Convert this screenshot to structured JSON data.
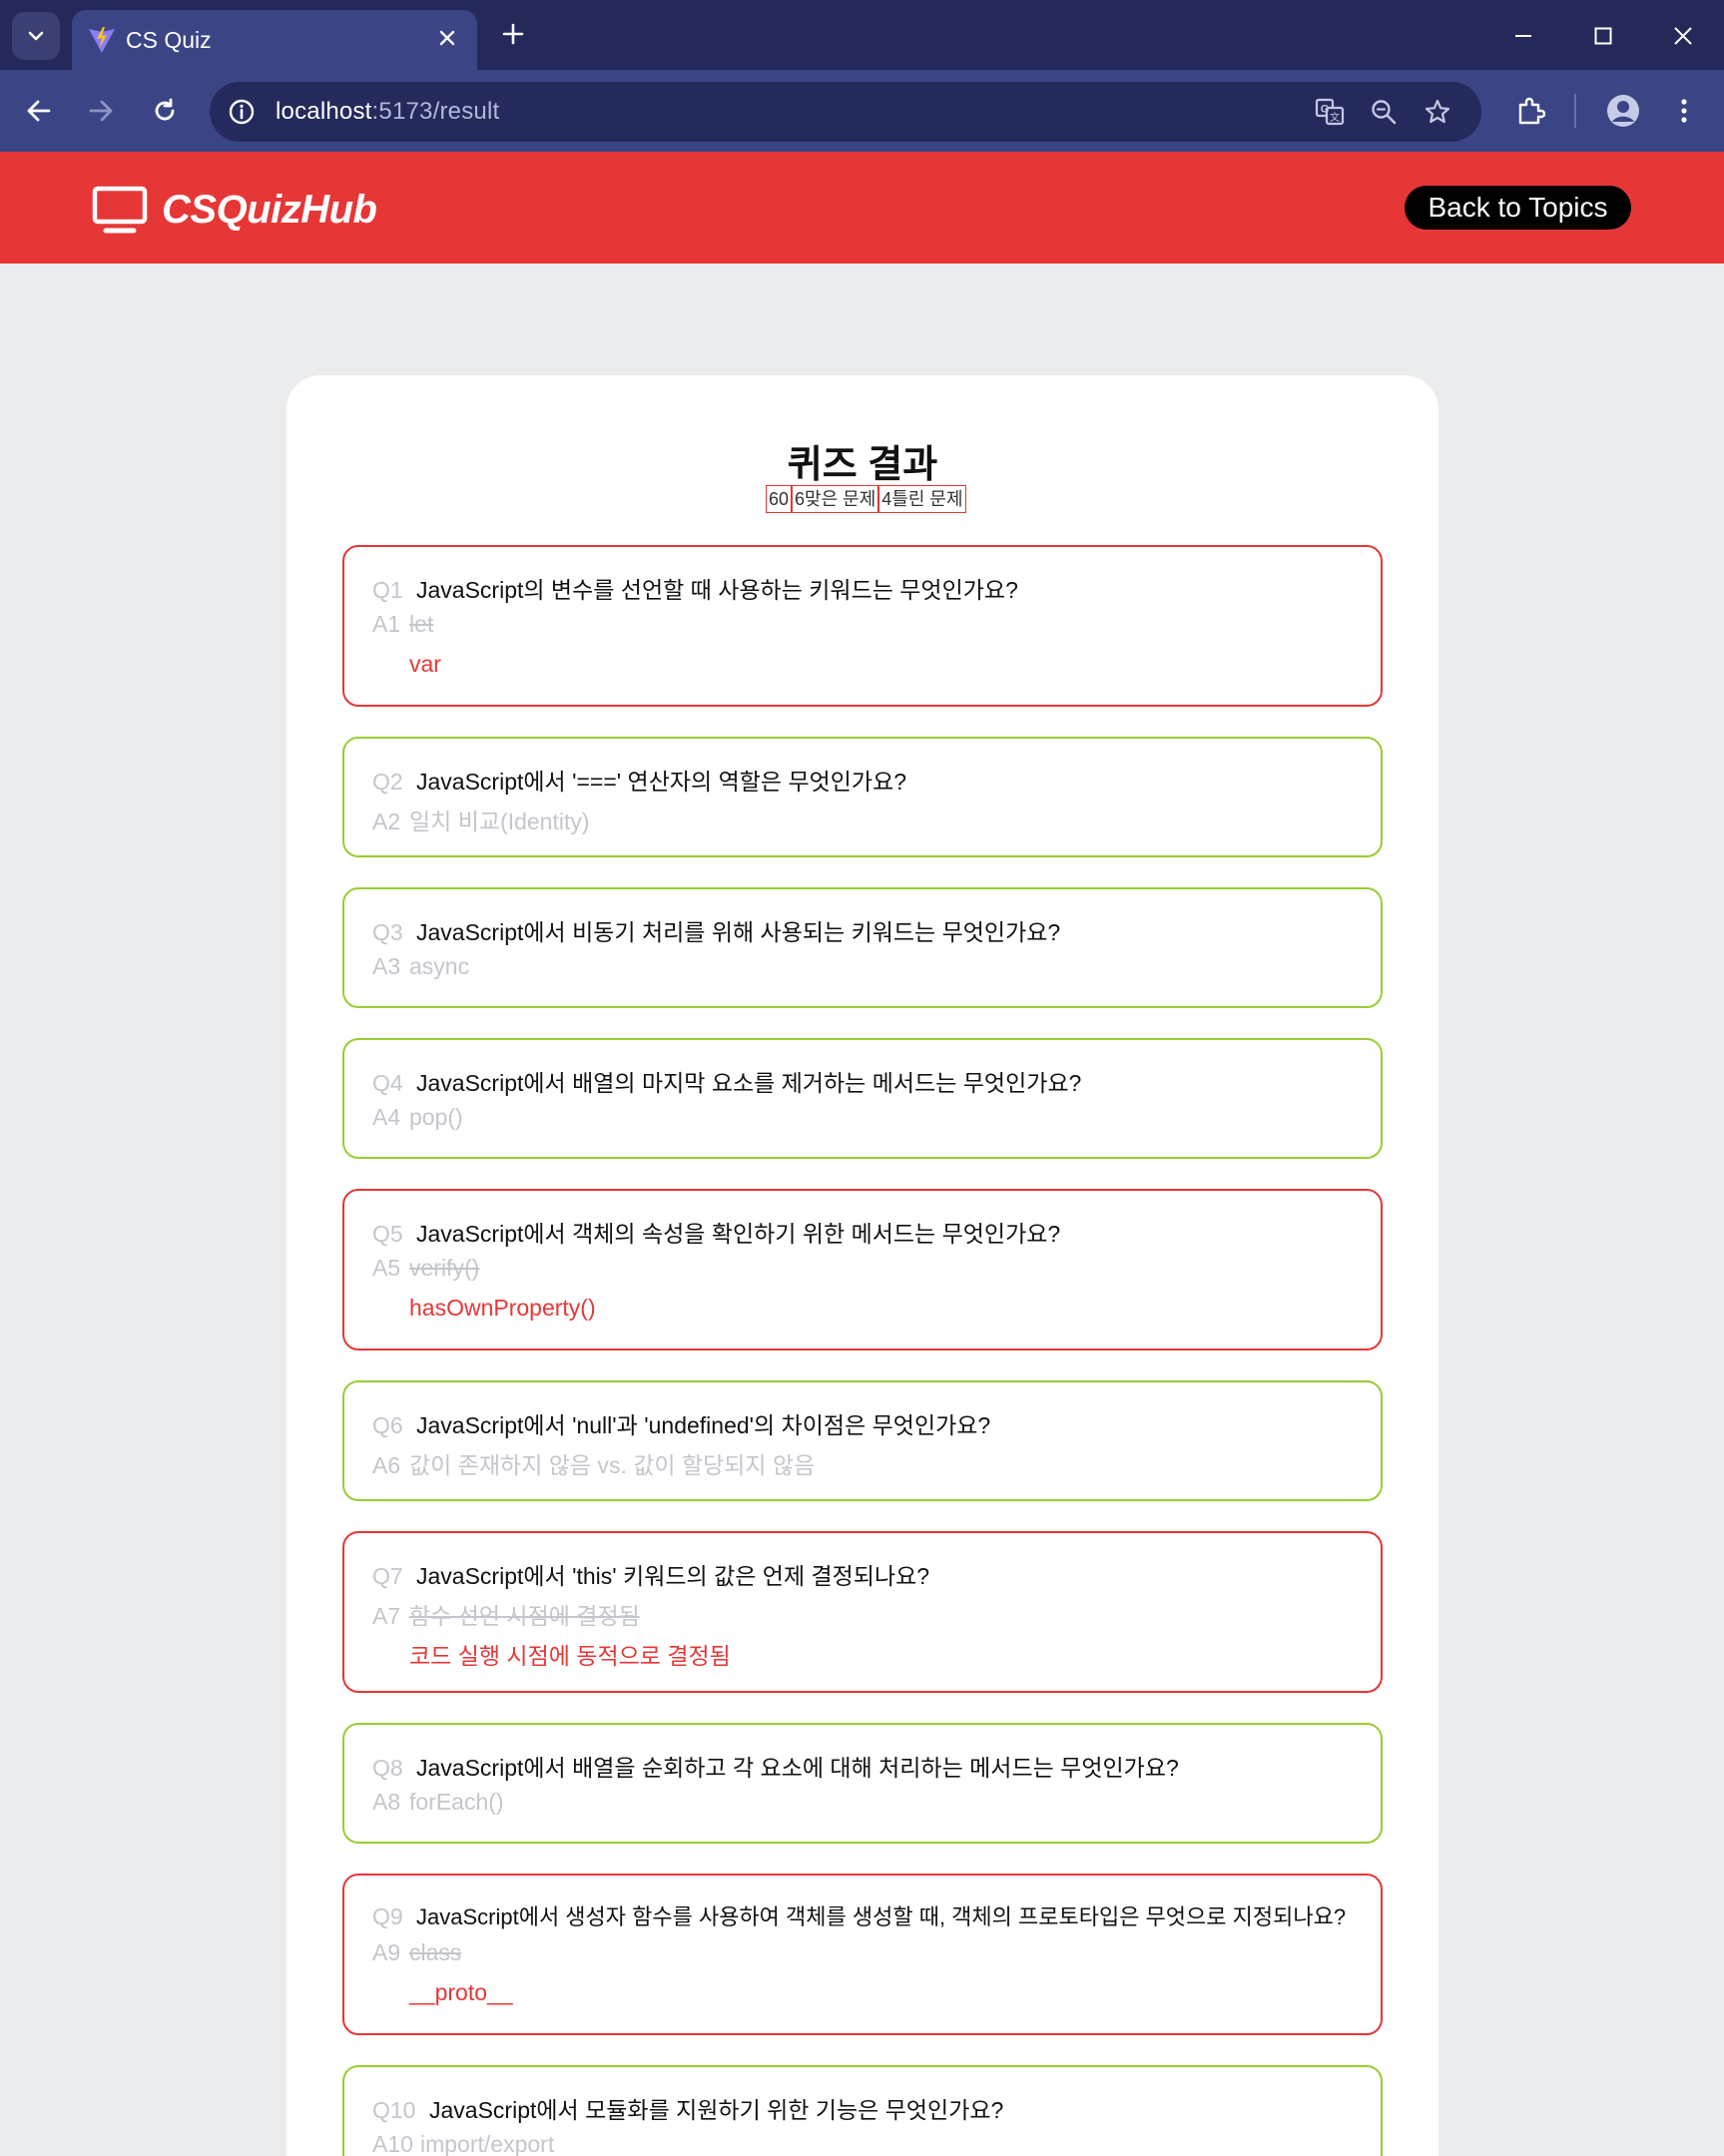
{
  "browser": {
    "tab_title": "CS Quiz",
    "url_host": "localhost",
    "url_rest": ":5173/result"
  },
  "header": {
    "logo_text": "CSQuizHub",
    "back_label": "Back to Topics",
    "brand_color": "#e73636"
  },
  "result": {
    "title": "퀴즈 결과",
    "score": "60",
    "correct_count": "6",
    "correct_label": "맞은 문제",
    "wrong_count": "4",
    "wrong_label": "틀린 문제"
  },
  "questions": [
    {
      "q_label": "Q1",
      "question": "JavaScript의 변수를 선언할 때 사용하는 키워드는 무엇인가요?",
      "a_label": "A1",
      "answer": "let",
      "correct_answer": "var",
      "is_correct": false
    },
    {
      "q_label": "Q2",
      "question": "JavaScript에서 '===' 연산자의 역할은 무엇인가요?",
      "a_label": "A2",
      "answer": "일치 비교(Identity)",
      "is_correct": true
    },
    {
      "q_label": "Q3",
      "question": "JavaScript에서 비동기 처리를 위해 사용되는 키워드는 무엇인가요?",
      "a_label": "A3",
      "answer": "async",
      "is_correct": true
    },
    {
      "q_label": "Q4",
      "question": "JavaScript에서 배열의 마지막 요소를 제거하는 메서드는 무엇인가요?",
      "a_label": "A4",
      "answer": "pop()",
      "is_correct": true
    },
    {
      "q_label": "Q5",
      "question": "JavaScript에서 객체의 속성을 확인하기 위한 메서드는 무엇인가요?",
      "a_label": "A5",
      "answer": "verify()",
      "correct_answer": "hasOwnProperty()",
      "is_correct": false
    },
    {
      "q_label": "Q6",
      "question": "JavaScript에서 'null'과 'undefined'의 차이점은 무엇인가요?",
      "a_label": "A6",
      "answer": "값이 존재하지 않음 vs. 값이 할당되지 않음",
      "is_correct": true
    },
    {
      "q_label": "Q7",
      "question": "JavaScript에서 'this' 키워드의 값은 언제 결정되나요?",
      "a_label": "A7",
      "answer": "함수 선언 시점에 결정됨",
      "correct_answer": "코드 실행 시점에 동적으로 결정됨",
      "is_correct": false
    },
    {
      "q_label": "Q8",
      "question": "JavaScript에서 배열을 순회하고 각 요소에 대해 처리하는 메서드는 무엇인가요?",
      "a_label": "A8",
      "answer": "forEach()",
      "is_correct": true
    },
    {
      "q_label": "Q9",
      "question": "JavaScript에서 생성자 함수를 사용하여 객체를 생성할 때, 객체의 프로토타입은 무엇으로 지정되나요?",
      "a_label": "A9",
      "answer": "class",
      "correct_answer": "__proto__",
      "is_correct": false
    },
    {
      "q_label": "Q10",
      "question": "JavaScript에서 모듈화를 지원하기 위한 기능은 무엇인가요?",
      "a_label": "A10",
      "answer": "import/export",
      "is_correct": true
    }
  ]
}
